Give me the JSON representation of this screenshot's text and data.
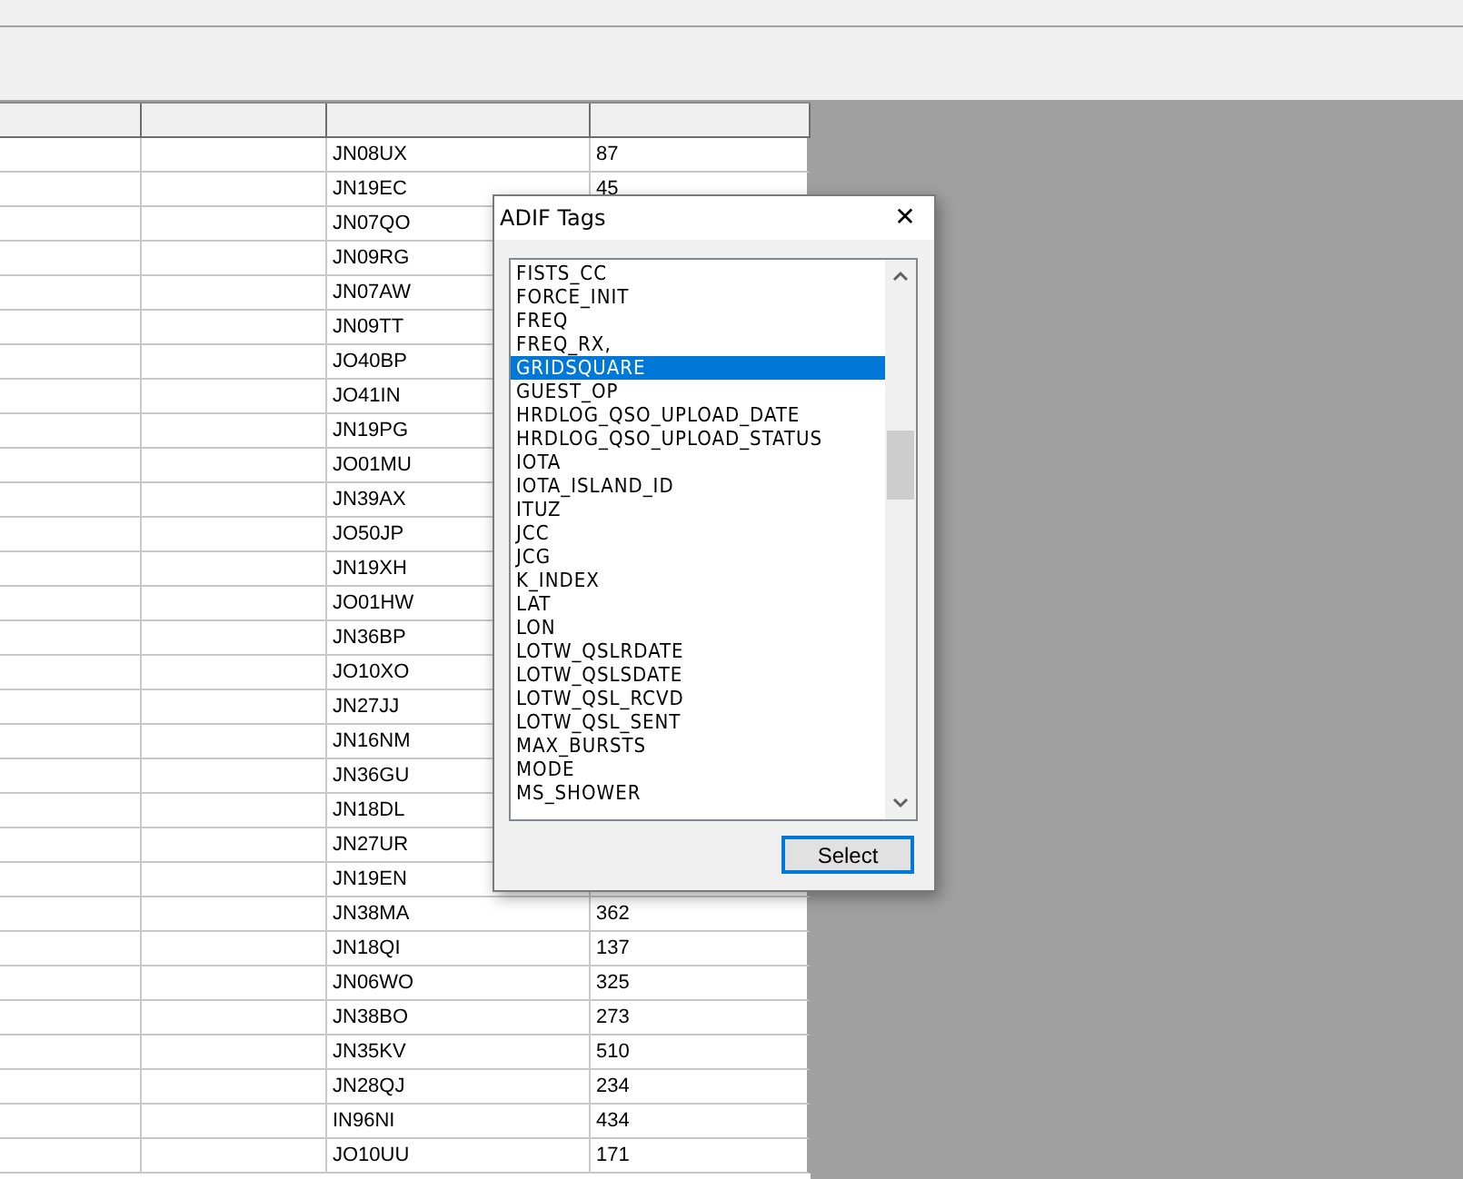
{
  "table": {
    "rows": [
      {
        "grid": "JN08UX",
        "value": "87"
      },
      {
        "grid": "JN19EC",
        "value": "45"
      },
      {
        "grid": "JN07QO"
      },
      {
        "grid": "JN09RG"
      },
      {
        "grid": "JN07AW"
      },
      {
        "grid": "JN09TT"
      },
      {
        "grid": "JO40BP"
      },
      {
        "grid": "JO41IN"
      },
      {
        "grid": "JN19PG"
      },
      {
        "grid": "JO01MU"
      },
      {
        "grid": "JN39AX"
      },
      {
        "grid": "JO50JP"
      },
      {
        "grid": "JN19XH"
      },
      {
        "grid": "JO01HW"
      },
      {
        "grid": "JN36BP"
      },
      {
        "grid": "JO10XO"
      },
      {
        "grid": "JN27JJ"
      },
      {
        "grid": "JN16NM"
      },
      {
        "grid": "JN36GU"
      },
      {
        "grid": "JN18DL"
      },
      {
        "grid": "JN27UR"
      },
      {
        "grid": "JN19EN"
      },
      {
        "grid": "JN38MA",
        "value": "362"
      },
      {
        "grid": "JN18QI",
        "value": "137"
      },
      {
        "grid": "JN06WO",
        "value": "325"
      },
      {
        "grid": "JN38BO",
        "value": "273"
      },
      {
        "grid": "JN35KV",
        "value": "510"
      },
      {
        "grid": "JN28QJ",
        "value": "234"
      },
      {
        "grid": "IN96NI",
        "value": "434"
      },
      {
        "grid": "JO10UU",
        "value": "171"
      }
    ]
  },
  "dialog": {
    "title": "ADIF Tags",
    "close": "✕",
    "items": [
      {
        "label": "FISTS_CC",
        "selected": false
      },
      {
        "label": "FORCE_INIT",
        "selected": false
      },
      {
        "label": "FREQ",
        "selected": false
      },
      {
        "label": "FREQ_RX,",
        "selected": false
      },
      {
        "label": "GRIDSQUARE",
        "selected": true
      },
      {
        "label": "GUEST_OP",
        "selected": false
      },
      {
        "label": "HRDLOG_QSO_UPLOAD_DATE",
        "selected": false
      },
      {
        "label": "HRDLOG_QSO_UPLOAD_STATUS",
        "selected": false
      },
      {
        "label": "IOTA",
        "selected": false
      },
      {
        "label": "IOTA_ISLAND_ID",
        "selected": false
      },
      {
        "label": "ITUZ",
        "selected": false
      },
      {
        "label": "JCC",
        "selected": false
      },
      {
        "label": "JCG",
        "selected": false
      },
      {
        "label": "K_INDEX",
        "selected": false
      },
      {
        "label": "LAT",
        "selected": false
      },
      {
        "label": "LON",
        "selected": false
      },
      {
        "label": "LOTW_QSLRDATE",
        "selected": false
      },
      {
        "label": "LOTW_QSLSDATE",
        "selected": false
      },
      {
        "label": "LOTW_QSL_RCVD",
        "selected": false
      },
      {
        "label": "LOTW_QSL_SENT",
        "selected": false
      },
      {
        "label": "MAX_BURSTS",
        "selected": false
      },
      {
        "label": "MODE",
        "selected": false
      },
      {
        "label": "MS_SHOWER",
        "selected": false
      }
    ],
    "button": "Select"
  }
}
